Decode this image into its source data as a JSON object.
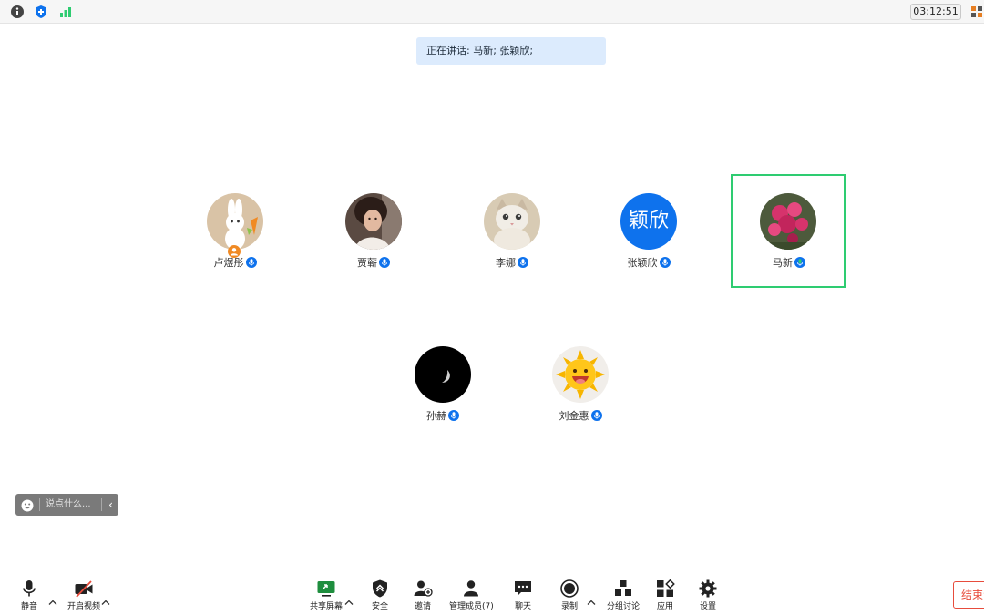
{
  "topbar": {
    "icons": [
      "info-icon",
      "shield-icon",
      "signal-icon"
    ],
    "timer": "03:12:51",
    "right_icon": "grid-icon"
  },
  "speaking_banner": "正在讲话: 马新; 张颖欣;",
  "participants": [
    {
      "name": "卢煜彤",
      "avatar": "bunny-avatar",
      "host": true
    },
    {
      "name": "贾蕲",
      "avatar": "photo-avatar"
    },
    {
      "name": "李娜",
      "avatar": "cat-avatar"
    },
    {
      "name": "张颖欣",
      "avatar": "text-avatar",
      "avatar_text": "颖欣",
      "avatar_color": "#0e72ed"
    },
    {
      "name": "马新",
      "avatar": "flower-avatar",
      "active_speaker": true
    },
    {
      "name": "孙赫",
      "avatar": "moon-avatar"
    },
    {
      "name": "刘金惠",
      "avatar": "sun-avatar"
    }
  ],
  "chat": {
    "placeholder": "说点什么...",
    "collapse": "‹"
  },
  "toolbar": {
    "mute": "静音",
    "video": "开启视频",
    "share": "共享屏幕",
    "security": "安全",
    "invite": "邀请",
    "participants": "管理成员(7)",
    "chat": "聊天",
    "record": "录制",
    "breakout": "分组讨论",
    "apps": "应用",
    "settings": "设置",
    "end": "结束会议"
  },
  "colors": {
    "accent_blue": "#0e72ed",
    "active_border": "#2ecc71",
    "end_red": "#e74c3c",
    "banner_bg": "#dcebfd"
  }
}
